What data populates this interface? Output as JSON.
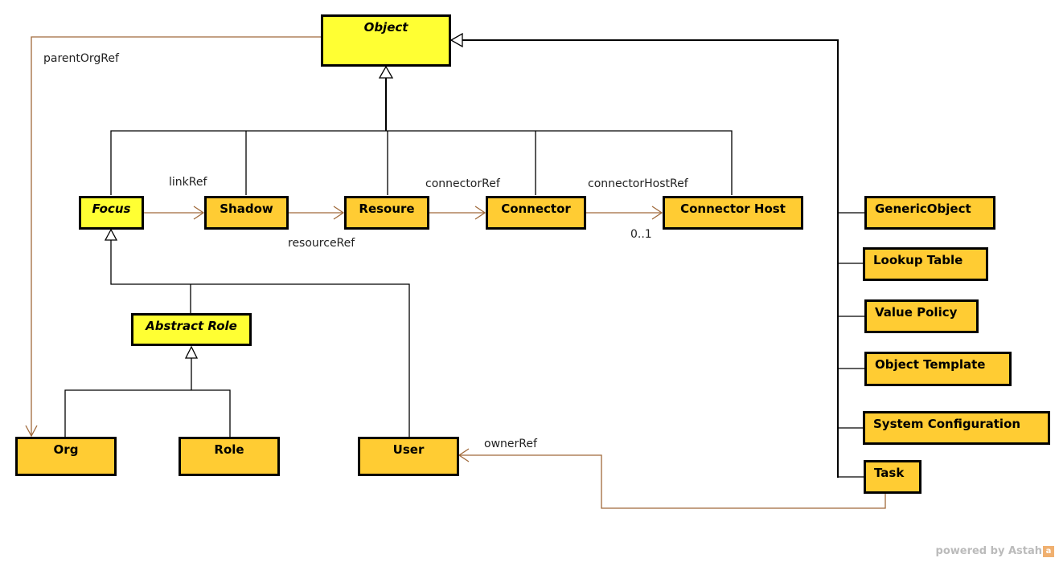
{
  "diagram": {
    "type": "UML class diagram",
    "colors": {
      "abstract_fill": "#ffff33",
      "class_fill": "#ffcc33",
      "generalization": "#000000",
      "association": "#a0693a"
    },
    "classes": {
      "object": "Object",
      "focus": "Focus",
      "shadow": "Shadow",
      "resource": "Resoure",
      "connector": "Connector",
      "connector_host": "Connector Host",
      "abstract_role": "Abstract Role",
      "org": "Org",
      "role": "Role",
      "user": "User",
      "generic_object": "GenericObject",
      "lookup_table": "Lookup Table",
      "value_policy": "Value Policy",
      "object_template": "Object Template",
      "system_configuration": "System Configuration",
      "task": "Task"
    },
    "associations": {
      "parent_org_ref": "parentOrgRef",
      "link_ref": "linkRef",
      "resource_ref": "resourceRef",
      "connector_ref": "connectorRef",
      "connector_host_ref": "connectorHostRef",
      "connector_host_multiplicity": "0..1",
      "owner_ref": "ownerRef"
    }
  },
  "footer": {
    "text": "powered by Astah",
    "logo": "a"
  }
}
